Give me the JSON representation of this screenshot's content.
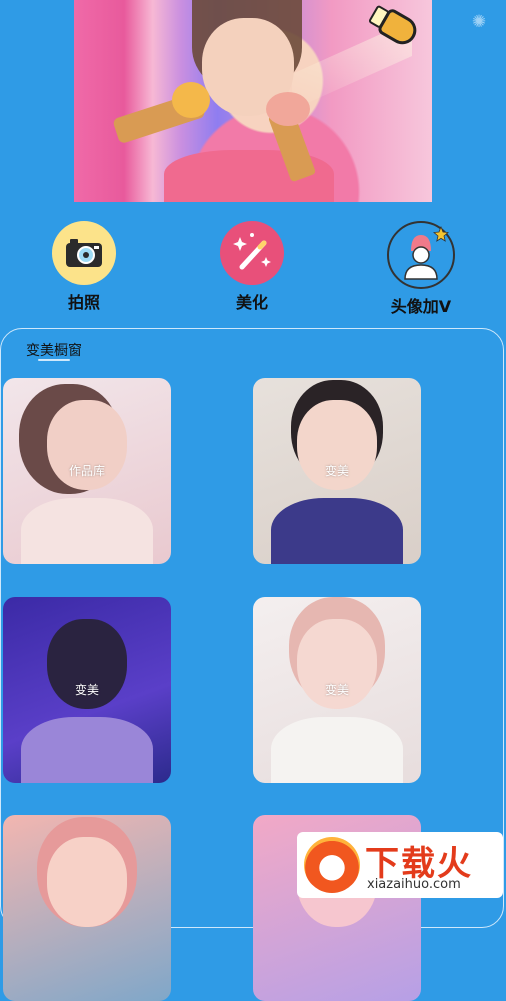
{
  "banner": {
    "settings_icon": "gear-icon"
  },
  "features": [
    {
      "label": "拍照",
      "icon": "camera-icon"
    },
    {
      "label": "美化",
      "icon": "magic-wand-icon"
    },
    {
      "label": "头像加V",
      "icon": "avatar-v-icon"
    }
  ],
  "section": {
    "title": "变美橱窗"
  },
  "cards": [
    {
      "tag": "作品库"
    },
    {
      "tag": "变美"
    },
    {
      "tag": "变美"
    },
    {
      "tag": "变美"
    },
    {
      "tag": ""
    },
    {
      "tag": ""
    }
  ],
  "watermark": {
    "title": "下载火",
    "subtitle": "xiazaihuo.com"
  },
  "colors": {
    "background": "#2f9be6",
    "camera_bg": "#fce38a",
    "beauty_bg": "#e8507a"
  }
}
